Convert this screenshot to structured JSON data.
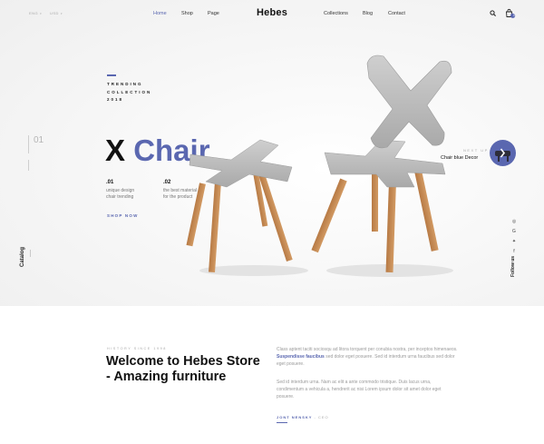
{
  "header": {
    "lang": "ENG",
    "currency": "USD",
    "nav_left": [
      "Home",
      "Shop",
      "Page"
    ],
    "logo": "Hebes",
    "nav_right": [
      "Collections",
      "Blog",
      "Contact"
    ],
    "cart_count": "0",
    "accent": "#5a67b0"
  },
  "hero": {
    "counter": "01",
    "trend_line1": "TRENDING",
    "trend_line2": "COLLECTION",
    "trend_line3": "2018",
    "title_x": "X",
    "title_chair": "Chair",
    "features": [
      {
        "num": ".01",
        "line1": "unique design",
        "line2": "chair trending"
      },
      {
        "num": ".02",
        "line1": "the best material",
        "line2": "for the product"
      }
    ],
    "shop_now": "SHOP NOW",
    "catalog": "Catalog",
    "next_up_label": "NEXT UP",
    "next_up_text": "Chair blue Decor",
    "follow": "Follow us",
    "socials": [
      "facebook-icon",
      "twitter-icon",
      "google-plus-icon",
      "instagram-icon"
    ]
  },
  "intro": {
    "history": "HISTORY SINCE 1998",
    "welcome": "Welcome to Hebes Store - Amazing furniture",
    "para1_a": "Class aptent taciti sociosqu ad litora torquent per conubia nostra, per inceptos himenaeos.",
    "para1_em": "Suspendisse faucibus",
    "para1_b": "sed dolor eget posuere. Sed id interdum urna faucibus sed dolor eget posuere.",
    "para2": "Sed id interdum urna. Nam ac elit a ante commodo tristique. Duis lacus urna, condimentum a vehicula a, hendrerit ac nisi Lorem ipsum dolor sit amet dolor eget posuere.",
    "author": "JONT NENSKY",
    "author_role": "- CEO"
  }
}
